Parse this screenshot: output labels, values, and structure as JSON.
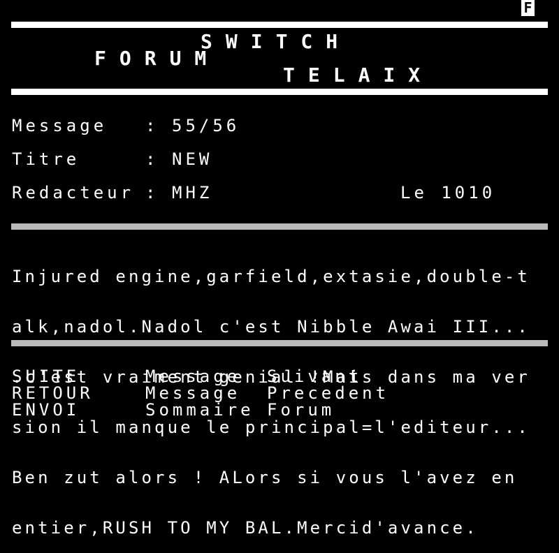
{
  "status": {
    "indicator": "F"
  },
  "header": {
    "line1": "SWITCH",
    "line2": "FORUM",
    "line3": "TELAIX"
  },
  "meta": {
    "message_label": "Message",
    "message_value": "55/56",
    "title_label": "Titre",
    "title_value": "NEW",
    "author_label": "Redacteur",
    "author_value": "MHZ",
    "date_text": "Le 1010",
    "separator": ":"
  },
  "message": {
    "lines": [
      "Injured engine,garfield,extasie,double-t",
      "alk,nadol.Nadol c'est Nibble Awai III...",
      ".c'est vraiment genial !Mais dans ma ver",
      "sion il manque le principal=l'editeur...",
      "Ben zut alors ! ALors si vous l'avez en",
      "entier,RUSH TO MY BAL.Mercid'avance."
    ]
  },
  "menu": [
    {
      "key": "SUITE",
      "target": "Message",
      "action": "Suivant"
    },
    {
      "key": "RETOUR",
      "target": "Message",
      "action": "Precedent"
    },
    {
      "key": "ENVOI",
      "target": "Sommaire",
      "action": "Forum"
    }
  ]
}
